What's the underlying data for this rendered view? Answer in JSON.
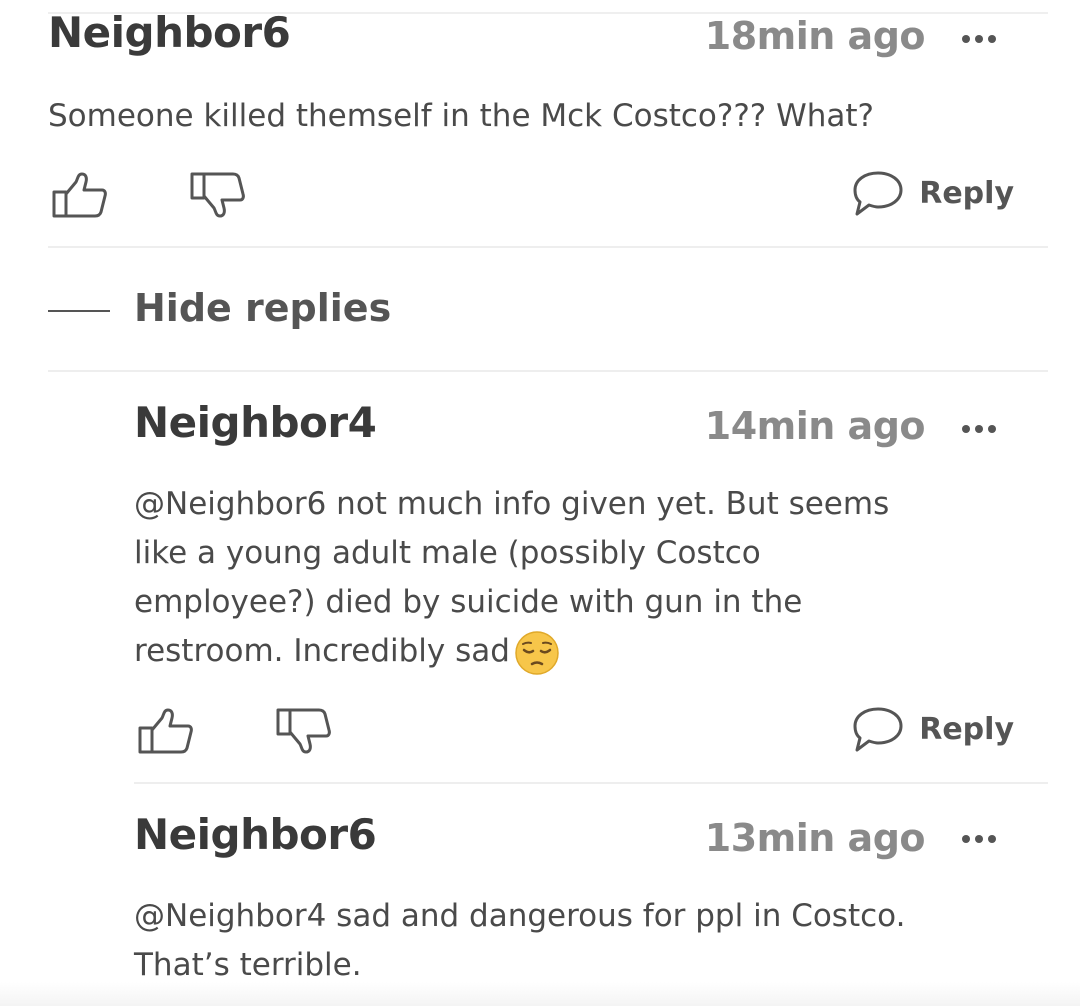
{
  "comments": [
    {
      "author": "Neighbor6",
      "time": "18min ago",
      "text": "Someone killed themself in the Mck Costco??? What?",
      "reply_label": "Reply"
    },
    {
      "author": "Neighbor4",
      "time": "14min ago",
      "mention": "@Neighbor6",
      "text_line1": " not much info given yet. But seems",
      "text_line2": "like a young adult male (possibly Costco",
      "text_line3": "employee?) died by suicide with gun in the",
      "text_line4": "restroom. Incredibly sad",
      "emoji": "pensive-face",
      "reply_label": "Reply"
    },
    {
      "author": "Neighbor6",
      "time": "13min ago",
      "mention": "@Neighbor4",
      "text_line1": " sad and dangerous for ppl in Costco.",
      "text_line2": "That’s terrible."
    }
  ],
  "thread": {
    "hide_replies_label": "Hide replies"
  },
  "colors": {
    "author": "#3a3a3a",
    "timestamp": "#8a8a8a",
    "body_text": "#4a4a4a",
    "icons": "#555555"
  }
}
